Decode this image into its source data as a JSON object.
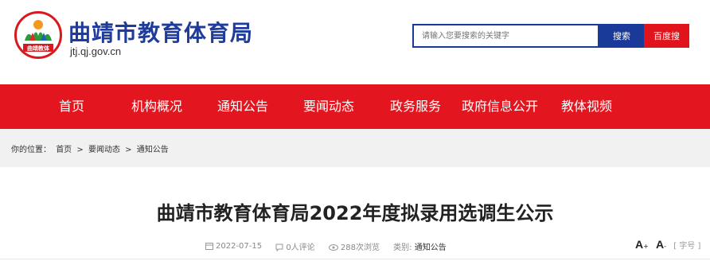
{
  "header": {
    "logo_text": "曲靖教体",
    "site_name": "曲靖市教育体育局",
    "site_url": "jtj.qj.gov.cn"
  },
  "search": {
    "placeholder": "请输入您要搜索的关键字",
    "search_label": "搜索",
    "baidu_label": "百度搜"
  },
  "nav": {
    "items": [
      {
        "label": "首页"
      },
      {
        "label": "机构概况"
      },
      {
        "label": "通知公告"
      },
      {
        "label": "要闻动态"
      },
      {
        "label": "政务服务"
      },
      {
        "label": "政府信息公开"
      },
      {
        "label": "教体视频"
      }
    ]
  },
  "breadcrumb": {
    "prefix": "你的位置：",
    "items": [
      "首页",
      ">",
      "要闻动态",
      ">",
      "通知公告"
    ]
  },
  "article": {
    "title": "曲靖市教育体育局2022年度拟录用选调生公示",
    "date": "2022-07-15",
    "comments": "0人评论",
    "views": "288次浏览",
    "category_label": "类别:",
    "category_value": "通知公告"
  },
  "font_control": {
    "increase": "A",
    "increase_sub": "+",
    "decrease": "A",
    "decrease_sub": "-",
    "label": "[ 字号 ]"
  },
  "colors": {
    "brand_blue": "#1a3a9a",
    "nav_red": "#e3161f"
  }
}
